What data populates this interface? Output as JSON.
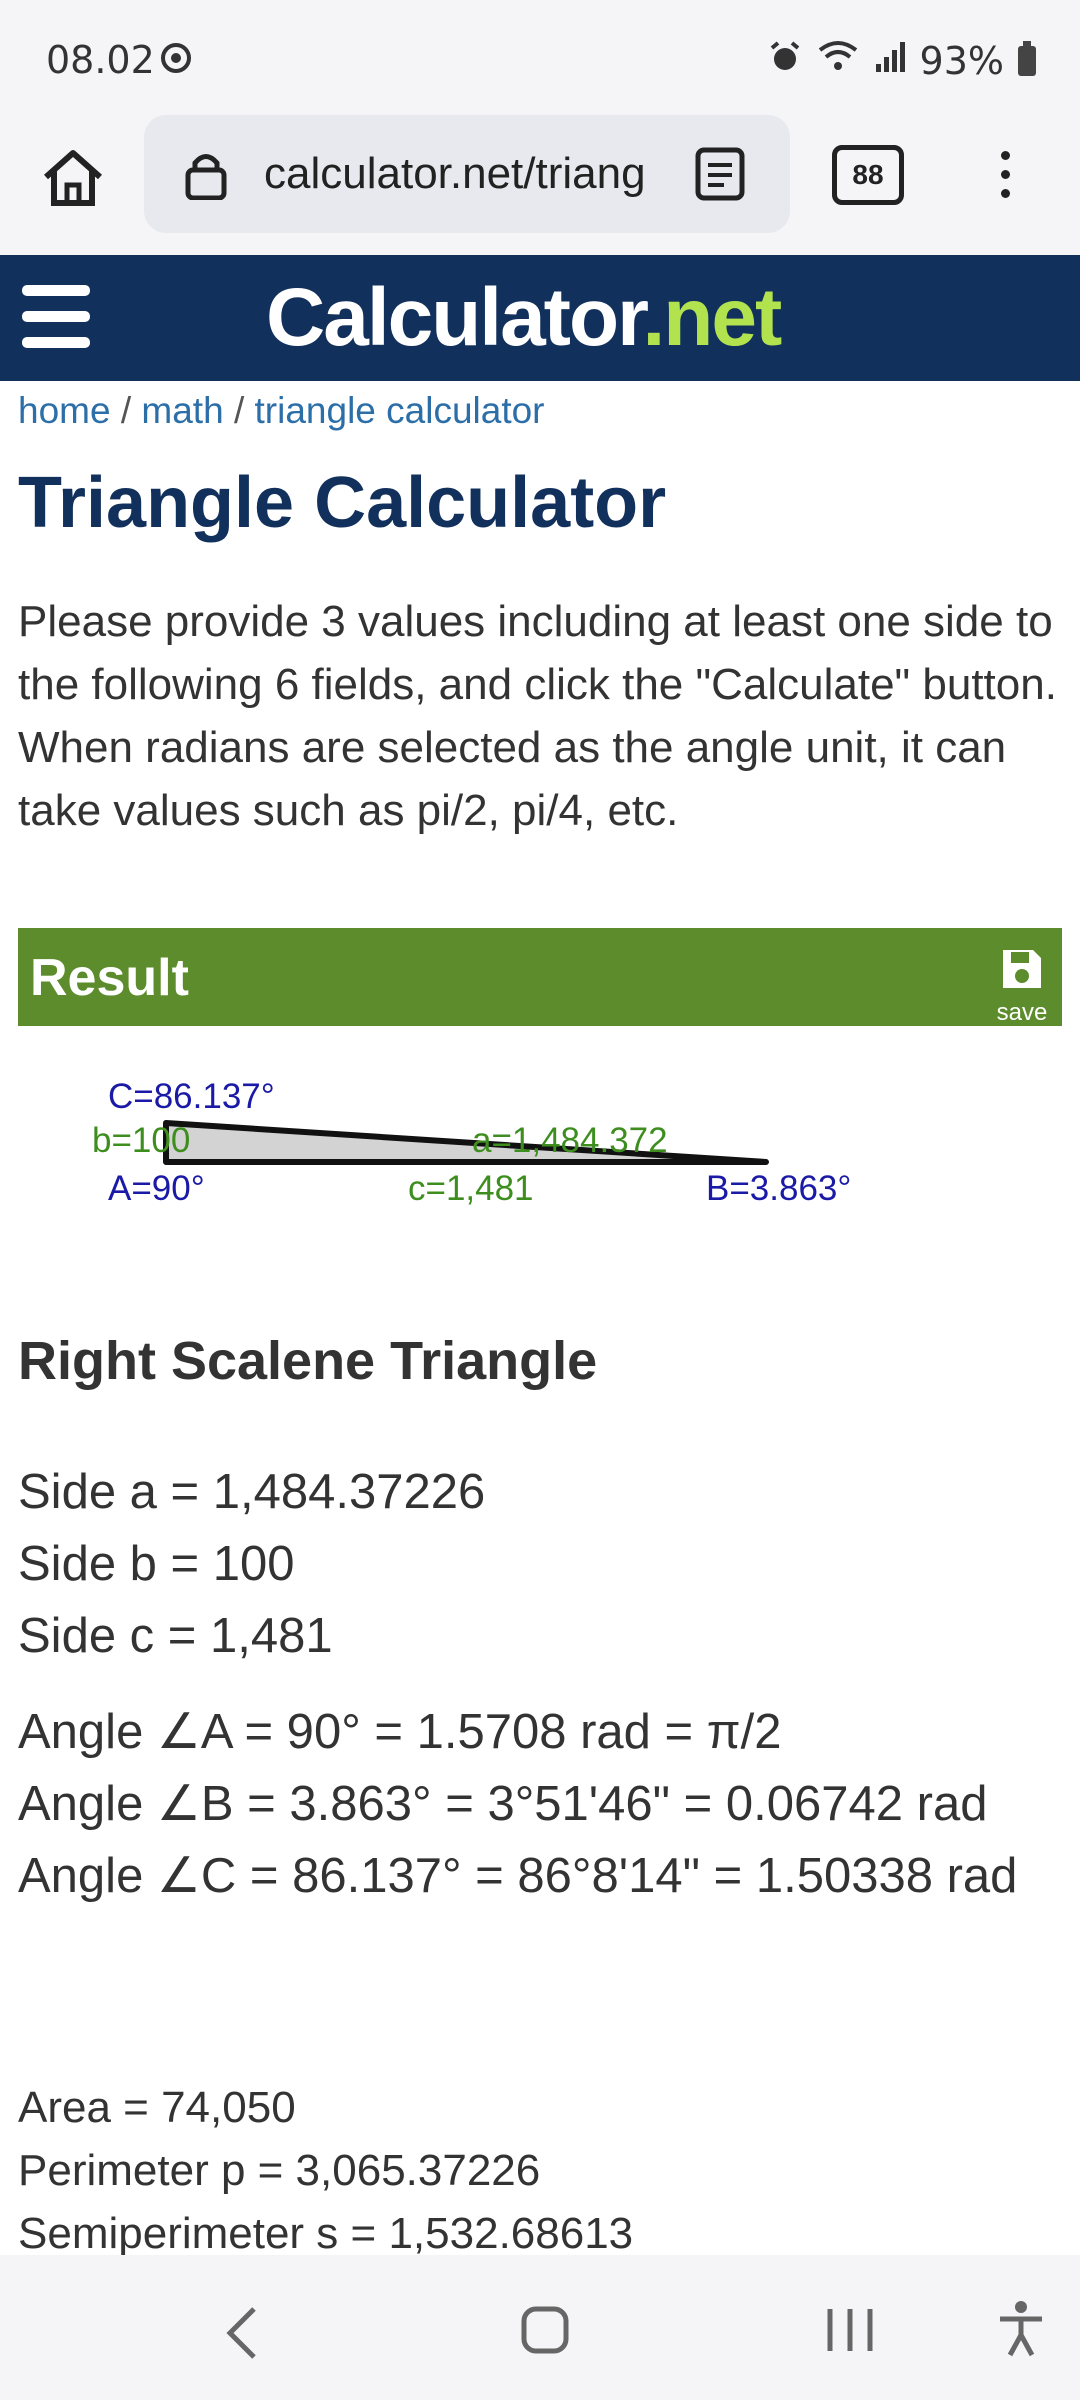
{
  "status": {
    "time": "08.02",
    "battery": "93%"
  },
  "browser": {
    "url": "calculator.net/triangle",
    "tab_count": "88"
  },
  "site": {
    "logo_main": "Calculator",
    "logo_dot": ".",
    "logo_net": "net"
  },
  "breadcrumb": {
    "home": "home",
    "sep1": " / ",
    "math": "math",
    "sep2": " / ",
    "current": "triangle calculator"
  },
  "page": {
    "title": "Triangle Calculator",
    "intro": "Please provide 3 values including at least one side to the following 6 fields, and click the \"Calculate\" button. When radians are selected as the angle unit, it can take values such as pi/2, pi/4, etc."
  },
  "result": {
    "title": "Result",
    "save_label": "save"
  },
  "diagram": {
    "angle_C": "C=86.137°",
    "side_b": "b=100",
    "side_a": "a=1,484.372",
    "angle_A": "A=90°",
    "side_c": "c=1,481",
    "angle_B": "B=3.863°"
  },
  "triangle": {
    "type": "Right Scalene Triangle",
    "side_a": "Side a = 1,484.37226",
    "side_b": "Side b = 100",
    "side_c": "Side c = 1,481",
    "angle_A": "Angle ∠A = 90° = 1.5708 rad = π/2",
    "angle_B": "Angle ∠B = 3.863° = 3°51'46\" = 0.06742 rad",
    "angle_C": "Angle ∠C = 86.137° = 86°8'14\" = 1.50338 rad",
    "area": "Area = 74,050",
    "perimeter": "Perimeter p = 3,065.37226",
    "semiperimeter": "Semiperimeter s = 1,532.68613"
  }
}
